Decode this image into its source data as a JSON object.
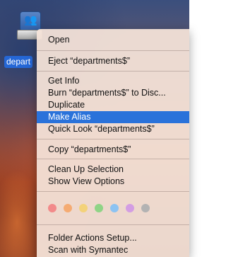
{
  "volume": {
    "label": "depart",
    "icon": "network-volume-icon"
  },
  "menu": {
    "items": [
      "Open",
      "Eject “departments$”",
      "Get Info",
      "Burn “departments$” to Disc...",
      "Duplicate",
      "Make Alias",
      "Quick Look “departments$”",
      "Copy “departments$”",
      "Clean Up Selection",
      "Show View Options",
      "Folder Actions Setup...",
      "Scan with Symantec"
    ],
    "highlighted_index": 5,
    "tag_colors": [
      "#f28a8a",
      "#f5ab72",
      "#f3d27a",
      "#8fd486",
      "#8cc3f2",
      "#d39de3",
      "#b3b3b3"
    ]
  }
}
